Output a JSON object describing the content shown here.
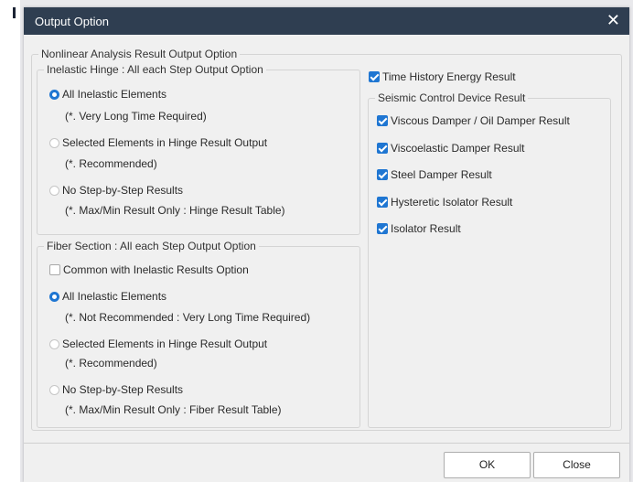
{
  "dialog": {
    "title": "Output Option",
    "close_glyph": "✕"
  },
  "main_group": {
    "legend": "Nonlinear Analysis Result Output Option"
  },
  "hinge": {
    "legend": "Inelastic Hinge : All each Step Output Option",
    "options": [
      {
        "label": "All Inelastic Elements",
        "note": "(*. Very Long Time Required)",
        "selected": true
      },
      {
        "label": "Selected Elements in Hinge Result Output",
        "note": "(*. Recommended)",
        "selected": false
      },
      {
        "label": "No Step-by-Step Results",
        "note": "(*. Max/Min Result Only : Hinge Result Table)",
        "selected": false
      }
    ]
  },
  "fiber": {
    "legend": "Fiber Section : All each Step Output Option",
    "common_label": "Common with Inelastic Results Option",
    "common_checked": false,
    "options": [
      {
        "label": "All Inelastic Elements",
        "note": "(*. Not Recommended : Very Long Time Required)",
        "selected": true
      },
      {
        "label": "Selected Elements in Hinge Result Output",
        "note": "(*. Recommended)",
        "selected": false
      },
      {
        "label": "No Step-by-Step Results",
        "note": "(*. Max/Min Result Only : Fiber Result Table)",
        "selected": false
      }
    ]
  },
  "energy": {
    "label": "Time History Energy Result",
    "checked": true
  },
  "seismic": {
    "legend": "Seismic Control Device Result",
    "items": [
      {
        "label": "Viscous Damper / Oil Damper Result",
        "checked": true
      },
      {
        "label": "Viscoelastic Damper Result",
        "checked": true
      },
      {
        "label": "Steel Damper Result",
        "checked": true
      },
      {
        "label": "Hysteretic Isolator Result",
        "checked": true
      },
      {
        "label": "Isolator Result",
        "checked": true
      }
    ]
  },
  "buttons": {
    "ok": "OK",
    "close": "Close"
  },
  "colors": {
    "titlebar": "#2f3e51",
    "accent": "#1f76d2",
    "dialog_bg": "#f0f0f0"
  }
}
